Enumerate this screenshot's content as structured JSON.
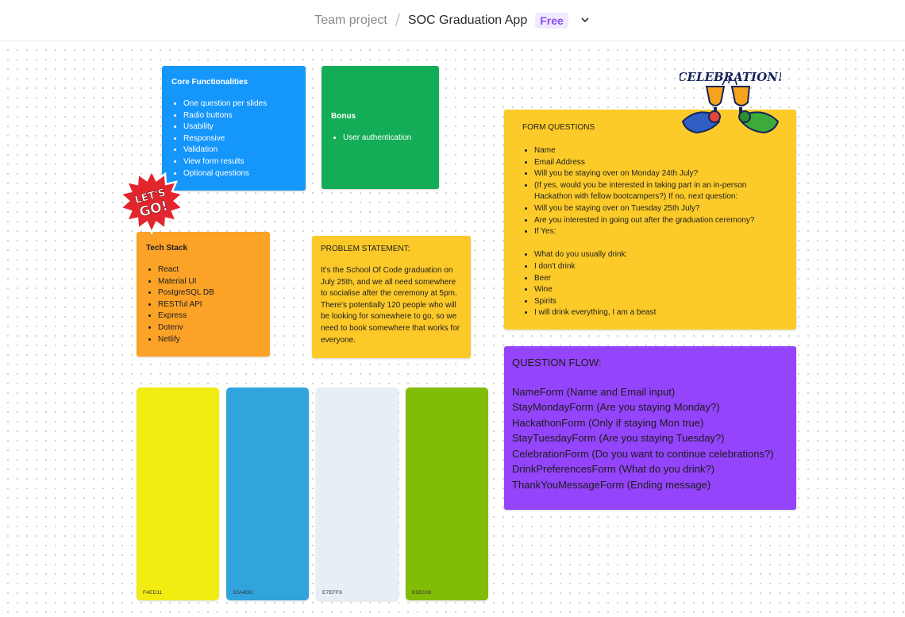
{
  "header": {
    "parent": "Team project",
    "separator": "/",
    "title": "SOC Graduation App",
    "plan_badge": "Free"
  },
  "notes": {
    "core": {
      "title": "Core Functionalities",
      "items": [
        "One question per slides",
        "Radio buttons",
        "Usability",
        "Responsive",
        "Validation",
        "View form results",
        "Optional questions"
      ],
      "color": "#1596FB"
    },
    "bonus": {
      "title": "Bonus",
      "items": [
        "User authentication"
      ],
      "color": "#13AD57"
    },
    "tech": {
      "title": "Tech Stack",
      "items": [
        "React",
        "Material UI",
        "PostgreSQL DB",
        "RESTful API",
        "Express",
        "Dotenv",
        "Netlify"
      ],
      "color": "#FBA227"
    },
    "problem": {
      "title": "PROBLEM STATEMENT:",
      "body": "It's the School Of Code graduation on July 25th, and we all need somewhere to socialise after the ceremony at 5pm. There's potentially 120 people who will be looking for somewhere to go, so we need to book somewhere that works for everyone.",
      "color": "#FCC929"
    },
    "form": {
      "title": "FORM QUESTIONS",
      "items": [
        "Name",
        "Email Address",
        "Will you be staying over on Monday 24th July?",
        "(If yes, would you be interested in taking part in an in-person Hackathon with fellow bootcampers?) If no, next question:",
        "Will you be staying over on Tuesday 25th July?",
        "Are you interested in going out after the graduation ceremony?",
        "If Yes:",
        "",
        "What do you usually drink:",
        "I don't drink",
        "Beer",
        "Wine",
        "Spirits",
        "I will drink everything, I am a beast"
      ],
      "color": "#FCCB29"
    },
    "flow": {
      "title": "QUESTION FLOW:",
      "lines": [
        "NameForm (Name and Email input)",
        "StayMondayForm (Are you staying Monday?)",
        "HackathonForm (Only if staying Mon true)",
        "StayTuesdayForm (Are you staying Tuesday?)",
        "CelebrationForm (Do you want to continue celebrations?)",
        "DrinkPreferencesForm (What do you drink?)",
        "ThankYouMessageForm (Ending message)"
      ],
      "color": "#9444FB"
    }
  },
  "swatches": [
    {
      "label": "F4ED11",
      "color": "#F2EC13"
    },
    {
      "label": "32A4DD",
      "color": "#32A4DD"
    },
    {
      "label": "E7EFF6",
      "color": "#E7EFF6"
    },
    {
      "label": "81BC06",
      "color": "#81BC06"
    }
  ],
  "stickers": {
    "lets_go": {
      "line1": "LET'S",
      "line2": "GO!",
      "icon": "lets-go-sticker"
    },
    "celebration": {
      "text": "CELEBRATION!",
      "icon": "celebration-toast-sticker"
    }
  }
}
